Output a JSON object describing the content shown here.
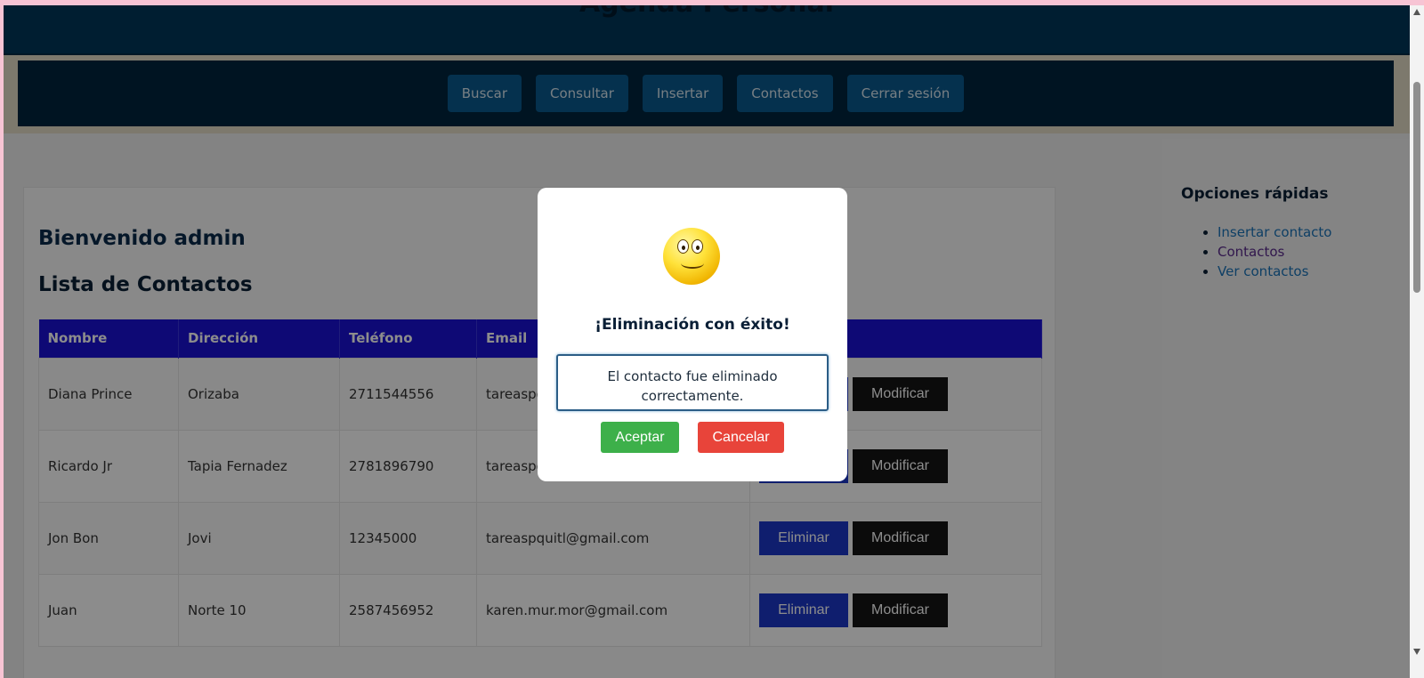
{
  "header": {
    "title": "Agenda Personal"
  },
  "nav": {
    "items": [
      "Buscar",
      "Consultar",
      "Insertar",
      "Contactos",
      "Cerrar sesión"
    ]
  },
  "main": {
    "welcome": "Bienvenido admin",
    "list_title": "Lista de Contactos",
    "table": {
      "headers": [
        "Nombre",
        "Dirección",
        "Teléfono",
        "Email",
        ""
      ],
      "rows": [
        {
          "nombre": "Diana Prince",
          "direccion": "Orizaba",
          "telefono": "2711544556",
          "email": "tareaspquitl@gmail.com"
        },
        {
          "nombre": "Ricardo Jr",
          "direccion": "Tapia Fernadez",
          "telefono": "2781896790",
          "email": "tareaspquitl@gmail.com"
        },
        {
          "nombre": "Jon Bon",
          "direccion": "Jovi",
          "telefono": "12345000",
          "email": "tareaspquitl@gmail.com"
        },
        {
          "nombre": "Juan",
          "direccion": "Norte 10",
          "telefono": "2587456952",
          "email": "karen.mur.mor@gmail.com"
        }
      ],
      "delete_label": "Eliminar",
      "modify_label": "Modificar"
    }
  },
  "sidebar": {
    "title": "Opciones rápidas",
    "links": [
      "Insertar contacto",
      "Contactos",
      "Ver contactos"
    ]
  },
  "modal": {
    "icon": "smiley-face-icon",
    "title": "¡Eliminación con éxito!",
    "message": "El contacto fue eliminado correctamente.",
    "accept_label": "Aceptar",
    "cancel_label": "Cancelar"
  },
  "colors": {
    "header_bg": "#01375a",
    "table_header_bg": "#1a12d6",
    "delete_button": "#1d37c9",
    "modify_button": "#141414",
    "accept_button": "#3db04a",
    "cancel_button": "#e8443a"
  }
}
